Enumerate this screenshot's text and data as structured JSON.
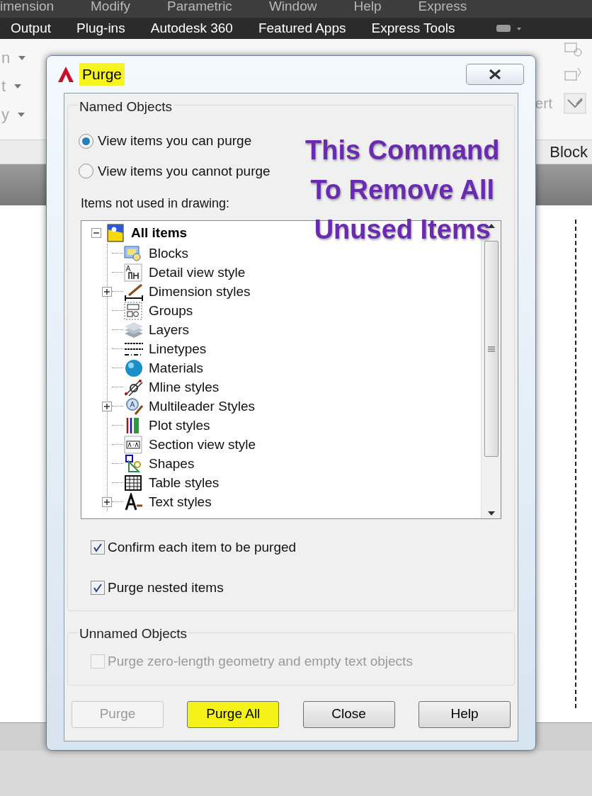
{
  "menu_bar": {
    "items": [
      "imension",
      "Modify",
      "Parametric",
      "Window",
      "Help",
      "Express"
    ]
  },
  "ribbon_tabs": {
    "items": [
      "Output",
      "Plug-ins",
      "Autodesk 360",
      "Featured Apps",
      "Express Tools"
    ]
  },
  "ribbon": {
    "left_labels": [
      "n",
      "t",
      "y"
    ],
    "right_label": "ert",
    "panel_title": "Block"
  },
  "dialog": {
    "title": "Purge",
    "title_highlighted": true,
    "named_group": {
      "label": "Named Objects",
      "radios": [
        {
          "label": "View items you can purge",
          "selected": true
        },
        {
          "label": "View items you cannot purge",
          "selected": false
        }
      ],
      "list_label": "Items not used in drawing:",
      "tree": {
        "label": "All items",
        "kind": "all",
        "expandable": true,
        "expanded": true,
        "children": [
          {
            "label": "Blocks",
            "kind": "block",
            "expandable": false
          },
          {
            "label": "Detail view style",
            "kind": "detail",
            "expandable": false
          },
          {
            "label": "Dimension styles",
            "kind": "dimension",
            "expandable": true,
            "expanded": false
          },
          {
            "label": "Groups",
            "kind": "group",
            "expandable": false
          },
          {
            "label": "Layers",
            "kind": "layer",
            "expandable": false
          },
          {
            "label": "Linetypes",
            "kind": "linetype",
            "expandable": false
          },
          {
            "label": "Materials",
            "kind": "material",
            "expandable": false
          },
          {
            "label": "Mline styles",
            "kind": "mline",
            "expandable": false
          },
          {
            "label": "Multileader Styles",
            "kind": "multileader",
            "expandable": true,
            "expanded": false
          },
          {
            "label": "Plot styles",
            "kind": "plot",
            "expandable": false
          },
          {
            "label": "Section view style",
            "kind": "section",
            "expandable": false
          },
          {
            "label": "Shapes",
            "kind": "shape",
            "expandable": false
          },
          {
            "label": "Table styles",
            "kind": "table",
            "expandable": false
          },
          {
            "label": "Text styles",
            "kind": "text",
            "expandable": true,
            "expanded": false
          }
        ]
      },
      "checkboxes": [
        {
          "label": "Confirm each item to be purged",
          "checked": true,
          "disabled": false
        },
        {
          "label": "Purge nested items",
          "checked": true,
          "disabled": false
        }
      ]
    },
    "unnamed_group": {
      "label": "Unnamed Objects",
      "checkboxes": [
        {
          "label": "Purge zero-length geometry and empty text objects",
          "checked": false,
          "disabled": true
        }
      ]
    },
    "buttons": [
      {
        "label": "Purge",
        "disabled": true,
        "highlighted": false
      },
      {
        "label": "Purge All",
        "disabled": false,
        "highlighted": true
      },
      {
        "label": "Close",
        "disabled": false,
        "highlighted": false
      },
      {
        "label": "Help",
        "disabled": false,
        "highlighted": false
      }
    ]
  },
  "annotation": {
    "lines": [
      "This Command",
      "To Remove All",
      "Unused Items"
    ]
  }
}
